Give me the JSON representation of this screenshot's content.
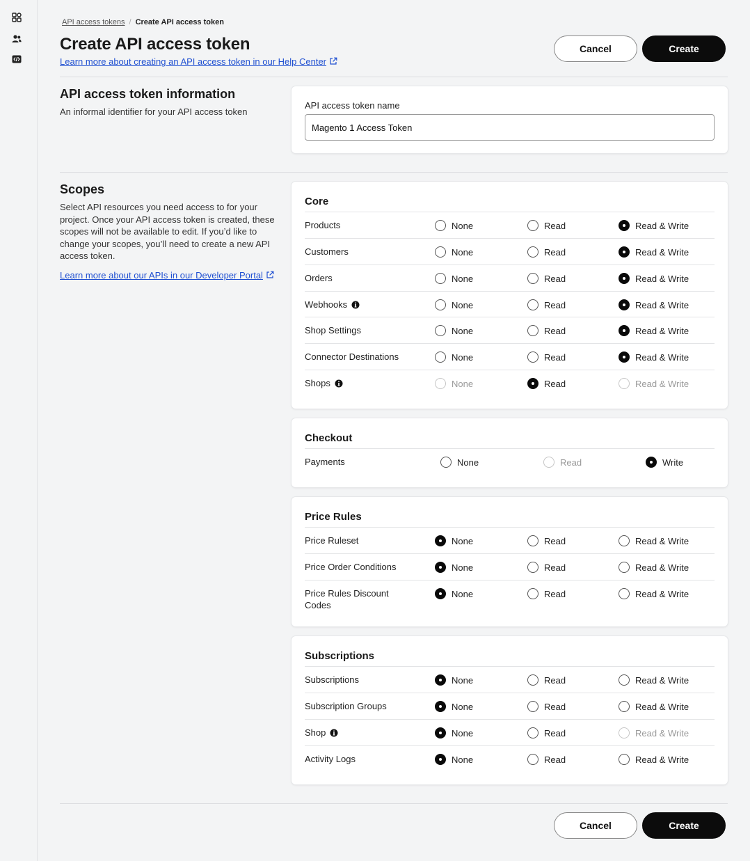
{
  "breadcrumb": {
    "parent": "API access tokens",
    "current": "Create API access token"
  },
  "page": {
    "title": "Create API access token",
    "help_link": "Learn more about creating an API access token in our Help Center"
  },
  "actions": {
    "cancel_label": "Cancel",
    "create_label": "Create"
  },
  "token_info": {
    "title": "API access token information",
    "description": "An informal identifier for your API access token",
    "field_label": "API access token name",
    "field_value": "Magento 1 Access Token"
  },
  "scopes": {
    "title": "Scopes",
    "description": "Select API resources you need access to for your project. Once your API access token is created, these scopes will not be available to edit. If you’d like to change your scopes, you’ll need to create a new API access token.",
    "dev_link": "Learn more about our APIs in our Developer Portal",
    "groups": [
      {
        "title": "Core",
        "options": [
          "None",
          "Read",
          "Read & Write"
        ],
        "rows": [
          {
            "label": "Products",
            "selected": "Read & Write"
          },
          {
            "label": "Customers",
            "selected": "Read & Write"
          },
          {
            "label": "Orders",
            "selected": "Read & Write"
          },
          {
            "label": "Webhooks",
            "selected": "Read & Write",
            "info": true
          },
          {
            "label": "Shop Settings",
            "selected": "Read & Write"
          },
          {
            "label": "Connector Destinations",
            "selected": "Read & Write"
          },
          {
            "label": "Shops",
            "selected": "Read",
            "info": true,
            "disabled": [
              "None",
              "Read & Write"
            ]
          }
        ]
      },
      {
        "title": "Checkout",
        "options": [
          "None",
          "Read",
          "Write"
        ],
        "rows": [
          {
            "label": "Payments",
            "selected": "Write",
            "disabled": [
              "Read"
            ]
          }
        ]
      },
      {
        "title": "Price Rules",
        "options": [
          "None",
          "Read",
          "Read & Write"
        ],
        "rows": [
          {
            "label": "Price Ruleset",
            "selected": "None"
          },
          {
            "label": "Price Order Conditions",
            "selected": "None"
          },
          {
            "label": "Price Rules Discount Codes",
            "selected": "None"
          }
        ]
      },
      {
        "title": "Subscriptions",
        "options": [
          "None",
          "Read",
          "Read & Write"
        ],
        "rows": [
          {
            "label": "Subscriptions",
            "selected": "None"
          },
          {
            "label": "Subscription Groups",
            "selected": "None"
          },
          {
            "label": "Shop",
            "selected": "None",
            "info": true,
            "disabled": [
              "Read & Write"
            ]
          },
          {
            "label": "Activity Logs",
            "selected": "None"
          }
        ]
      }
    ]
  },
  "sidebar": {
    "icons": [
      "apps-grid-icon",
      "users-icon",
      "code-icon"
    ]
  },
  "colors": {
    "link": "#1f4fd1",
    "primary": "#0c0c0c",
    "background": "#f3f4f5"
  }
}
